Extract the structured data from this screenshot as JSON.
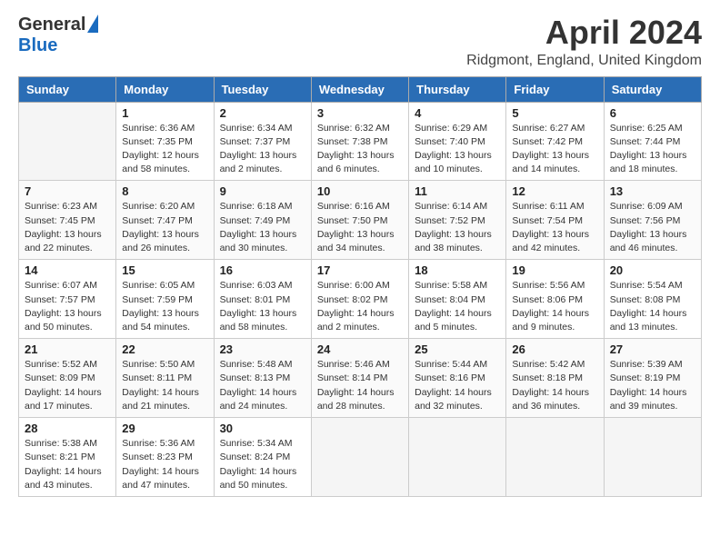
{
  "header": {
    "logo_general": "General",
    "logo_blue": "Blue",
    "title": "April 2024",
    "subtitle": "Ridgmont, England, United Kingdom"
  },
  "days_of_week": [
    "Sunday",
    "Monday",
    "Tuesday",
    "Wednesday",
    "Thursday",
    "Friday",
    "Saturday"
  ],
  "weeks": [
    [
      {
        "day": "",
        "info": ""
      },
      {
        "day": "1",
        "info": "Sunrise: 6:36 AM\nSunset: 7:35 PM\nDaylight: 12 hours\nand 58 minutes."
      },
      {
        "day": "2",
        "info": "Sunrise: 6:34 AM\nSunset: 7:37 PM\nDaylight: 13 hours\nand 2 minutes."
      },
      {
        "day": "3",
        "info": "Sunrise: 6:32 AM\nSunset: 7:38 PM\nDaylight: 13 hours\nand 6 minutes."
      },
      {
        "day": "4",
        "info": "Sunrise: 6:29 AM\nSunset: 7:40 PM\nDaylight: 13 hours\nand 10 minutes."
      },
      {
        "day": "5",
        "info": "Sunrise: 6:27 AM\nSunset: 7:42 PM\nDaylight: 13 hours\nand 14 minutes."
      },
      {
        "day": "6",
        "info": "Sunrise: 6:25 AM\nSunset: 7:44 PM\nDaylight: 13 hours\nand 18 minutes."
      }
    ],
    [
      {
        "day": "7",
        "info": "Sunrise: 6:23 AM\nSunset: 7:45 PM\nDaylight: 13 hours\nand 22 minutes."
      },
      {
        "day": "8",
        "info": "Sunrise: 6:20 AM\nSunset: 7:47 PM\nDaylight: 13 hours\nand 26 minutes."
      },
      {
        "day": "9",
        "info": "Sunrise: 6:18 AM\nSunset: 7:49 PM\nDaylight: 13 hours\nand 30 minutes."
      },
      {
        "day": "10",
        "info": "Sunrise: 6:16 AM\nSunset: 7:50 PM\nDaylight: 13 hours\nand 34 minutes."
      },
      {
        "day": "11",
        "info": "Sunrise: 6:14 AM\nSunset: 7:52 PM\nDaylight: 13 hours\nand 38 minutes."
      },
      {
        "day": "12",
        "info": "Sunrise: 6:11 AM\nSunset: 7:54 PM\nDaylight: 13 hours\nand 42 minutes."
      },
      {
        "day": "13",
        "info": "Sunrise: 6:09 AM\nSunset: 7:56 PM\nDaylight: 13 hours\nand 46 minutes."
      }
    ],
    [
      {
        "day": "14",
        "info": "Sunrise: 6:07 AM\nSunset: 7:57 PM\nDaylight: 13 hours\nand 50 minutes."
      },
      {
        "day": "15",
        "info": "Sunrise: 6:05 AM\nSunset: 7:59 PM\nDaylight: 13 hours\nand 54 minutes."
      },
      {
        "day": "16",
        "info": "Sunrise: 6:03 AM\nSunset: 8:01 PM\nDaylight: 13 hours\nand 58 minutes."
      },
      {
        "day": "17",
        "info": "Sunrise: 6:00 AM\nSunset: 8:02 PM\nDaylight: 14 hours\nand 2 minutes."
      },
      {
        "day": "18",
        "info": "Sunrise: 5:58 AM\nSunset: 8:04 PM\nDaylight: 14 hours\nand 5 minutes."
      },
      {
        "day": "19",
        "info": "Sunrise: 5:56 AM\nSunset: 8:06 PM\nDaylight: 14 hours\nand 9 minutes."
      },
      {
        "day": "20",
        "info": "Sunrise: 5:54 AM\nSunset: 8:08 PM\nDaylight: 14 hours\nand 13 minutes."
      }
    ],
    [
      {
        "day": "21",
        "info": "Sunrise: 5:52 AM\nSunset: 8:09 PM\nDaylight: 14 hours\nand 17 minutes."
      },
      {
        "day": "22",
        "info": "Sunrise: 5:50 AM\nSunset: 8:11 PM\nDaylight: 14 hours\nand 21 minutes."
      },
      {
        "day": "23",
        "info": "Sunrise: 5:48 AM\nSunset: 8:13 PM\nDaylight: 14 hours\nand 24 minutes."
      },
      {
        "day": "24",
        "info": "Sunrise: 5:46 AM\nSunset: 8:14 PM\nDaylight: 14 hours\nand 28 minutes."
      },
      {
        "day": "25",
        "info": "Sunrise: 5:44 AM\nSunset: 8:16 PM\nDaylight: 14 hours\nand 32 minutes."
      },
      {
        "day": "26",
        "info": "Sunrise: 5:42 AM\nSunset: 8:18 PM\nDaylight: 14 hours\nand 36 minutes."
      },
      {
        "day": "27",
        "info": "Sunrise: 5:39 AM\nSunset: 8:19 PM\nDaylight: 14 hours\nand 39 minutes."
      }
    ],
    [
      {
        "day": "28",
        "info": "Sunrise: 5:38 AM\nSunset: 8:21 PM\nDaylight: 14 hours\nand 43 minutes."
      },
      {
        "day": "29",
        "info": "Sunrise: 5:36 AM\nSunset: 8:23 PM\nDaylight: 14 hours\nand 47 minutes."
      },
      {
        "day": "30",
        "info": "Sunrise: 5:34 AM\nSunset: 8:24 PM\nDaylight: 14 hours\nand 50 minutes."
      },
      {
        "day": "",
        "info": ""
      },
      {
        "day": "",
        "info": ""
      },
      {
        "day": "",
        "info": ""
      },
      {
        "day": "",
        "info": ""
      }
    ]
  ]
}
